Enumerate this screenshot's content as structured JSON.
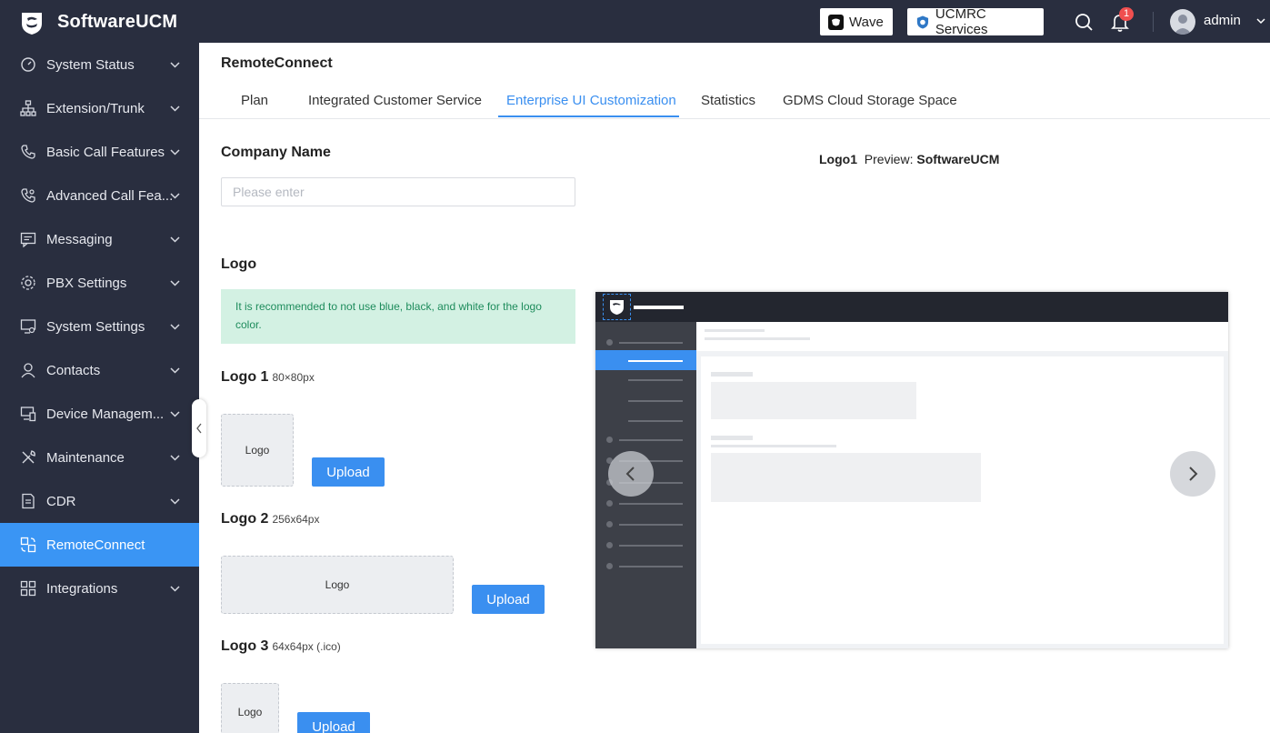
{
  "app": {
    "title": "SoftwareUCM"
  },
  "header": {
    "wave_label": "Wave",
    "ucmrc_label": "UCMRC Services",
    "notification_count": "1",
    "user": "admin"
  },
  "sidebar": {
    "items": [
      {
        "label": "System Status",
        "icon": "dashboard-icon"
      },
      {
        "label": "Extension/Trunk",
        "icon": "org-tree-icon"
      },
      {
        "label": "Basic Call Features",
        "icon": "phone-icon"
      },
      {
        "label": "Advanced Call Fea...",
        "icon": "phone-settings-icon"
      },
      {
        "label": "Messaging",
        "icon": "message-icon"
      },
      {
        "label": "PBX Settings",
        "icon": "gear-icon"
      },
      {
        "label": "System Settings",
        "icon": "monitor-settings-icon"
      },
      {
        "label": "Contacts",
        "icon": "user-icon"
      },
      {
        "label": "Device Managem...",
        "icon": "devices-icon"
      },
      {
        "label": "Maintenance",
        "icon": "tools-icon"
      },
      {
        "label": "CDR",
        "icon": "document-icon"
      },
      {
        "label": "RemoteConnect",
        "icon": "remote-icon",
        "active": true
      },
      {
        "label": "Integrations",
        "icon": "apps-icon"
      }
    ]
  },
  "main": {
    "title": "RemoteConnect",
    "tabs": [
      {
        "label": "Plan"
      },
      {
        "label": "Integrated Customer Service"
      },
      {
        "label": "Enterprise UI Customization",
        "active": true
      },
      {
        "label": "Statistics"
      },
      {
        "label": "GDMS Cloud Storage Space"
      }
    ],
    "company_name": {
      "title": "Company Name",
      "placeholder": "Please enter",
      "value": ""
    },
    "preview": {
      "logo_label": "Logo1",
      "preview_label": "Preview:",
      "preview_value": "SoftwareUCM"
    },
    "logo_section": {
      "title": "Logo",
      "tip": "It is recommended to not use blue, black, and white for the logo color.",
      "logos": [
        {
          "title": "Logo 1",
          "size": "80×80px",
          "box_label": "Logo",
          "upload_label": "Upload"
        },
        {
          "title": "Logo 2",
          "size": "256x64px",
          "box_label": "Logo",
          "upload_label": "Upload"
        },
        {
          "title": "Logo 3",
          "size": "64x64px (.ico)",
          "box_label": "Logo",
          "upload_label": "Upload"
        }
      ]
    }
  },
  "colors": {
    "sidebar_bg": "#292e3f",
    "accent": "#3a8ff0",
    "tip_bg": "#d3f1e3",
    "tip_text": "#1e8c5c",
    "badge": "#f04f4f"
  }
}
